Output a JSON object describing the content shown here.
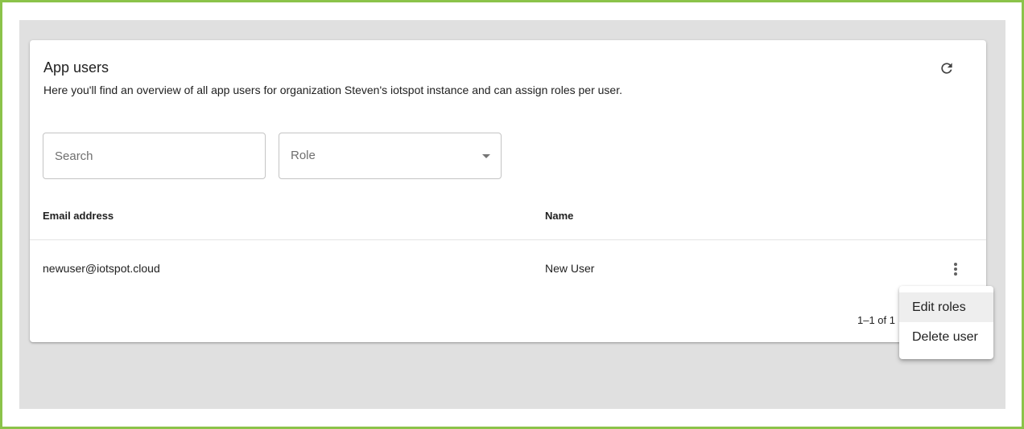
{
  "header": {
    "title": "App users",
    "description": "Here you'll find an overview of all app users for organization Steven's iotspot instance and can assign roles per user.",
    "refresh_icon": "refresh-icon"
  },
  "filters": {
    "search_placeholder": "Search",
    "role_label": "Role",
    "role_icon": "dropdown-arrow-icon"
  },
  "table": {
    "columns": [
      "Email address",
      "Name"
    ],
    "rows": [
      {
        "email": "newuser@iotspot.cloud",
        "name": "New User"
      }
    ],
    "pagination": "1–1 of 1"
  },
  "context_menu": {
    "items": [
      "Edit roles",
      "Delete user"
    ]
  },
  "colors": {
    "frame_border": "#8BC34A",
    "background": "#e0e0e0",
    "card": "#ffffff"
  }
}
